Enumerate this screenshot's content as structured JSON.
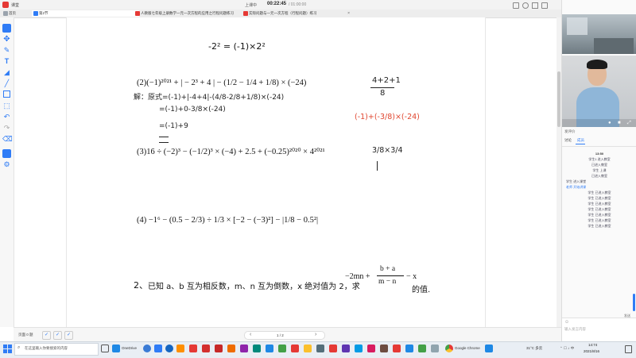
{
  "window": {
    "app_name": "课堂",
    "rec_label": "上课中",
    "timer": "00:22:45",
    "timer_sub": "/ 01:00:00",
    "end_button": "求助",
    "tabs": [
      {
        "label": "首页"
      },
      {
        "label": "第2节"
      },
      {
        "label": "人教版七年级上册数学一元一次方程的应用之行程问题练习"
      },
      {
        "label": "实际问题与一元一次方程（行程问题）练习"
      }
    ]
  },
  "document": {
    "line1": "-2² = (-1)×2²",
    "problem2": "(2)(−1)²⁰²¹ + | − 2³ + 4 | − (1/2 − 1/4 + 1/8) × (−24)",
    "hw_solution_1": "解：原式=(-1)+|-4+4|-(4/8-2/8+1/8)×(-24)",
    "hw_solution_2": "=(-1)+0-3/8×(-24)",
    "hw_solution_3": "=(-1)+9",
    "problem3": "(3)16 ÷ (−2)³ − (−1/2)³ × (−4) + 2.5 + (−0.25)²⁰²⁰ × 4²⁰²¹",
    "problem4": "(4) −1⁶ − (0.5 − 2/3) ÷ 1/3 × [−2 − (−3)²] − |1/8 − 0.5²|",
    "question2_num": "2、",
    "question2_text": "已知 a、b 互为相反数，m、n 互为倒数，x 绝对值为 2，求",
    "question2_expr_num": "b + a",
    "question2_expr_left": "−2mn +",
    "question2_expr_den": "m − n",
    "question2_expr_right": "− x",
    "question2_tail": "的值.",
    "side_top": "4+2+1",
    "side_den": "8",
    "side_red": "(-1)+(-3/8)×(-24)",
    "side_frac": "3/8×3/4"
  },
  "chat": {
    "tab_hint": "发评价",
    "tab_discuss": "讨论",
    "tab_members": "成员",
    "time": "13:50",
    "lines": [
      "学生1 进入教室",
      "已进入教室",
      "学生 上课",
      "已进入教室",
      "学生 进入课堂",
      "老师 开始讲课",
      "学生 已进入教室",
      "学生 已进入教室",
      "学生 已进入教室",
      "学生 已进入教室",
      "学生 已进入教室",
      "学生 已进入教室",
      "学生 已进入教室"
    ],
    "input_placeholder": "输入发言内容",
    "send": "发送"
  },
  "bottom": {
    "page_label": "页面 0 题",
    "page_indicator": "1 / 2",
    "prev": "‹",
    "next": "›"
  },
  "taskbar": {
    "search_placeholder": "在这里输入你要搜索的内容",
    "apps": [
      "OneDrive",
      "",
      "",
      "",
      "",
      "",
      "",
      "",
      "",
      "",
      "",
      "",
      "",
      "",
      "",
      "",
      "",
      "",
      "Google Chrome"
    ],
    "app_wps": "",
    "temperature": "31°C 多云",
    "time": "14:74",
    "date": "2021/8/16"
  },
  "colors": {
    "red_ink": "#e0452e",
    "black_ink": "#222222",
    "accent": "#2f7cf6"
  }
}
